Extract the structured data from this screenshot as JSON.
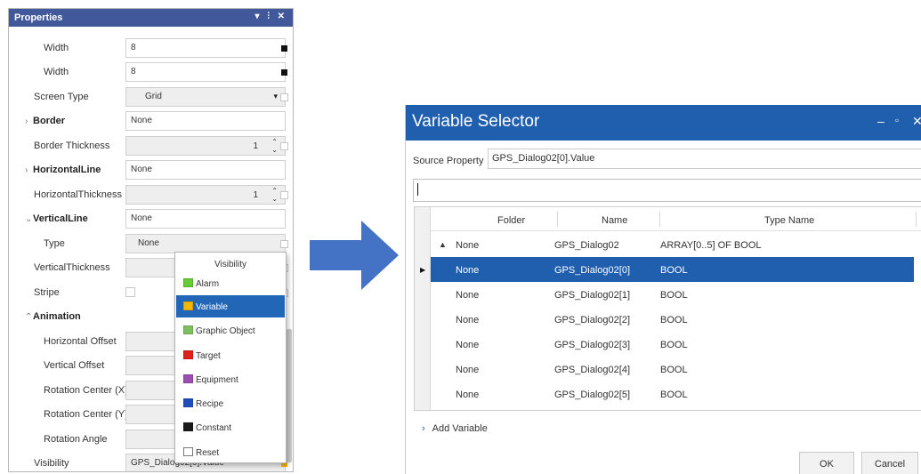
{
  "properties": {
    "title": "Properties",
    "controls": "▾ ⫶ ✕",
    "rows": [
      {
        "label": "Width",
        "value": "8"
      },
      {
        "label": "Width",
        "value": "8"
      },
      {
        "label": "Screen Type",
        "value": "Grid"
      },
      {
        "label": "Border",
        "value": "None"
      },
      {
        "label": "Border Thickness",
        "value": "1"
      },
      {
        "label": "HorizontalLine",
        "value": "None"
      },
      {
        "label": "HorizontalThickness",
        "value": "1"
      },
      {
        "label": "VerticalLine",
        "value": "None"
      },
      {
        "label": "Type",
        "value": "None"
      },
      {
        "label": "VerticalThickness",
        "value": ""
      },
      {
        "label": "Stripe",
        "value": ""
      },
      {
        "label": "Animation",
        "value": ""
      },
      {
        "label": "Horizontal Offset",
        "value": ""
      },
      {
        "label": "Vertical Offset",
        "value": ""
      },
      {
        "label": "Rotation Center (X)",
        "value": ""
      },
      {
        "label": "Rotation Center (Y)",
        "value": ""
      },
      {
        "label": "Rotation Angle",
        "value": ""
      },
      {
        "label": "Visibility",
        "value": "GPS_Dialog02[0].Value"
      }
    ]
  },
  "visibility_popup": {
    "header": "Visibility",
    "items": [
      {
        "label": "Alarm",
        "color": "#66cc33"
      },
      {
        "label": "Variable",
        "color": "#f5b800"
      },
      {
        "label": "Graphic Object",
        "color": "#7fbf5f"
      },
      {
        "label": "Target",
        "color": "#e0201b"
      },
      {
        "label": "Equipment",
        "color": "#9b4fb0"
      },
      {
        "label": "Recipe",
        "color": "#1f4fbf"
      },
      {
        "label": "Constant",
        "color": "#1a1a1a"
      },
      {
        "label": "Reset",
        "color": "#ffffff"
      }
    ],
    "selected": "Variable"
  },
  "variable_selector": {
    "title": "Variable Selector",
    "source_label": "Source Property",
    "source_value": "GPS_Dialog02[0].Value",
    "search_value": "",
    "columns": [
      "Folder",
      "Name",
      "Type Name"
    ],
    "rows": [
      {
        "folder": "None",
        "name": "GPS_Dialog02",
        "type": "ARRAY[0..5] OF BOOL",
        "expanded": true
      },
      {
        "folder": "None",
        "name": "GPS_Dialog02[0]",
        "type": "BOOL"
      },
      {
        "folder": "None",
        "name": "GPS_Dialog02[1]",
        "type": "BOOL"
      },
      {
        "folder": "None",
        "name": "GPS_Dialog02[2]",
        "type": "BOOL"
      },
      {
        "folder": "None",
        "name": "GPS_Dialog02[3]",
        "type": "BOOL"
      },
      {
        "folder": "None",
        "name": "GPS_Dialog02[4]",
        "type": "BOOL"
      },
      {
        "folder": "None",
        "name": "GPS_Dialog02[5]",
        "type": "BOOL"
      }
    ],
    "selected_row": 1,
    "add_variable": "Add Variable",
    "ok_label": "OK",
    "cancel_label": "Cancel"
  },
  "colors": {
    "accent": "#1f5fae",
    "panel_title": "#41599b",
    "arrow": "#4472c4"
  }
}
